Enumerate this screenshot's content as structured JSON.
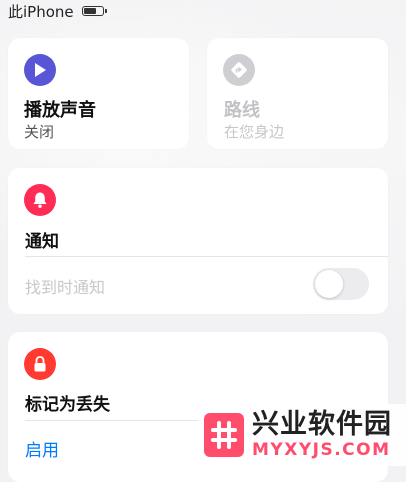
{
  "status_bar": {
    "device": "此iPhone"
  },
  "play_sound": {
    "title": "播放声音",
    "status": "关闭"
  },
  "directions": {
    "title": "路线",
    "subtitle": "在您身边"
  },
  "notifications": {
    "title": "通知",
    "notify_when_found": "找到时通知",
    "notify_when_found_on": false
  },
  "lost_mode": {
    "title": "标记为丢失",
    "action": "启用"
  },
  "watermark": {
    "name": "兴业软件园",
    "url": "MYXYJS.COM"
  },
  "colors": {
    "play_icon": "#5856d6",
    "notify_icon": "#ff2d55",
    "lost_icon": "#ff3b30",
    "link": "#007aff",
    "directions_icon": "#cfcfd3"
  }
}
